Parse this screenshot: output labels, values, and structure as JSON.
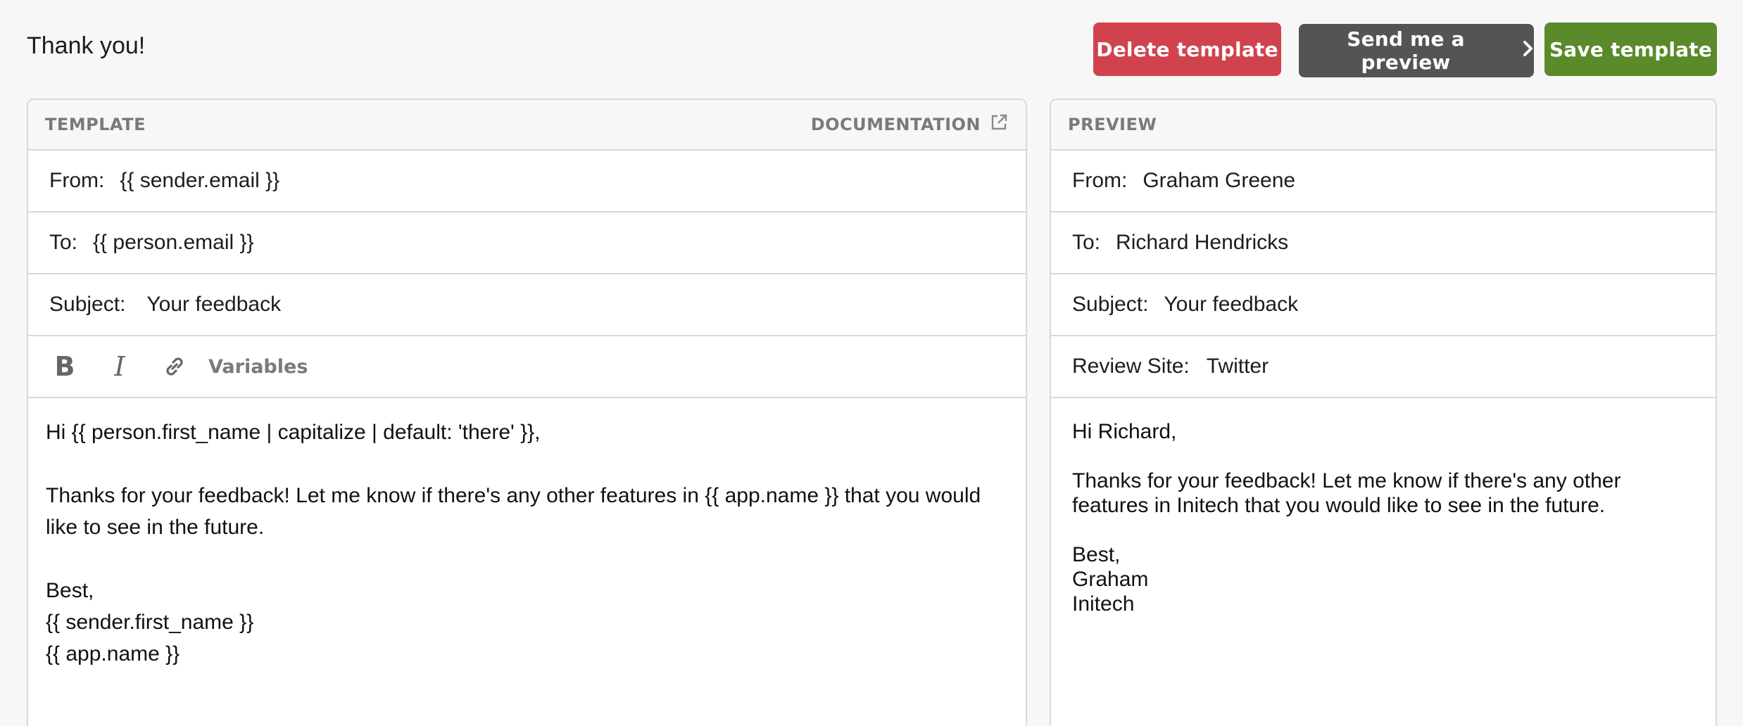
{
  "header": {
    "title": "Thank you!",
    "delete_label": "Delete template",
    "preview_label": "Send me a preview",
    "save_label": "Save template"
  },
  "colors": {
    "delete": "#d0434e",
    "preview": "#545454",
    "save": "#5a8a2a"
  },
  "template": {
    "heading": "TEMPLATE",
    "documentation_label": "DOCUMENTATION",
    "from_label": "From:",
    "from_value": "{{ sender.email }}",
    "to_label": "To:",
    "to_value": "{{ person.email }}",
    "subject_label": "Subject:",
    "subject_value": "Your feedback",
    "toolbar": {
      "bold": "B",
      "italic": "I",
      "variables_label": "Variables",
      "icons": [
        "bold-icon",
        "italic-icon",
        "link-icon"
      ]
    },
    "body": {
      "greeting": "Hi {{ person.first_name | capitalize | default: 'there' }},",
      "message_line1": "Thanks for your feedback! Let me know if there's any other features in {{ app.name }} that you would",
      "message_line2": "like to see in the future.",
      "signoff": "Best,",
      "sender": "{{ sender.first_name }}",
      "app": "{{ app.name }}"
    }
  },
  "preview": {
    "heading": "PREVIEW",
    "from_label": "From:",
    "from_value": "Graham Greene",
    "to_label": "To:",
    "to_value": "Richard Hendricks",
    "subject_label": "Subject:",
    "subject_value": "Your feedback",
    "review_label": "Review Site:",
    "review_value": "Twitter",
    "body": {
      "greeting": "Hi Richard,",
      "message_line1": "Thanks for your feedback! Let me know if there's any other",
      "message_line2": "features in Initech that you would like to see in the future.",
      "signoff": "Best,",
      "sender": "Graham",
      "app": "Initech"
    }
  }
}
